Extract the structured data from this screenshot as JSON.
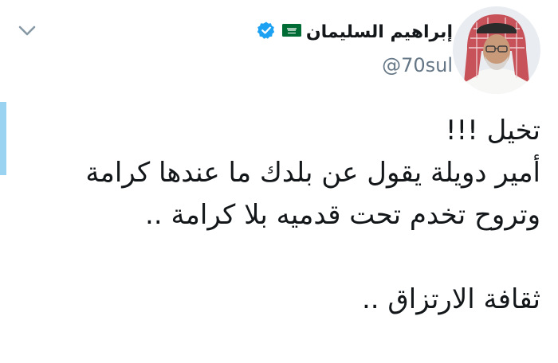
{
  "author": {
    "display_name": "إبراهيم السليمان",
    "handle": "@70sul",
    "verified": true,
    "flag": "saudi-arabia-flag-icon"
  },
  "tweet": {
    "lines": [
      "تخيل !!!",
      "أمير دويلة يقول عن بلدك ما عندها كرامة",
      "وتروح تخدم تحت قدميه بلا كرامة ..",
      "ثقافة الارتزاق .."
    ]
  },
  "colors": {
    "text": "#14171a",
    "secondary": "#657786",
    "verified_blue": "#1da1f2",
    "accent_bar": "#9ad2f2",
    "flag_green": "#006c35"
  }
}
